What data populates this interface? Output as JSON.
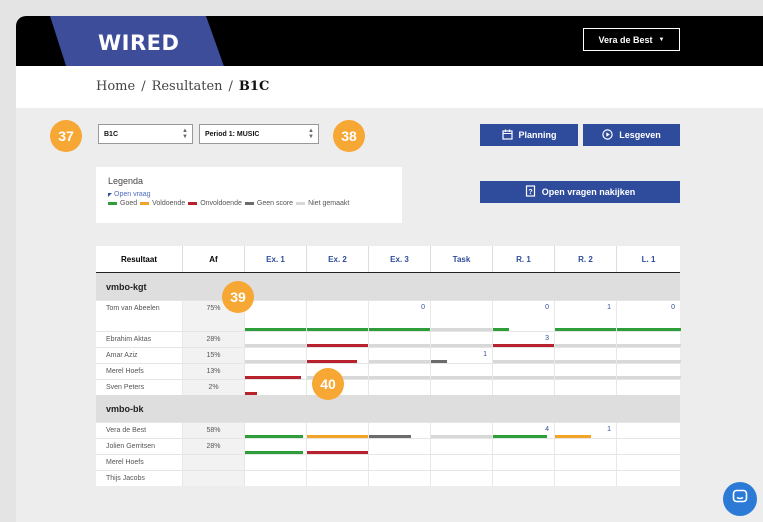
{
  "header": {
    "logo": "WIRED",
    "user_name": "Vera de Best",
    "user_caret": "▼"
  },
  "breadcrumb": {
    "home": "Home",
    "sep1": "/",
    "results": "Resultaten",
    "sep2": "/",
    "current": "B1C"
  },
  "filters": {
    "class_value": "B1C",
    "period_value": "Period 1: MUSIC"
  },
  "buttons": {
    "planning": "Planning",
    "lesgeven": "Lesgeven",
    "open_vragen": "Open vragen nakijken"
  },
  "callouts": {
    "a": "37",
    "b": "38",
    "c": "39",
    "d": "40"
  },
  "legend": {
    "title": "Legenda",
    "open_vraag": "Open vraag",
    "items": [
      {
        "label": "Goed",
        "color": "#2e9e3b"
      },
      {
        "label": "Voldoende",
        "color": "#f2a428"
      },
      {
        "label": "Onvoldoende",
        "color": "#b8222e"
      },
      {
        "label": "Geen score",
        "color": "#6b6b6b"
      },
      {
        "label": "Niet gemaakt",
        "color": "#d8d8d8"
      }
    ]
  },
  "table": {
    "headers": [
      "Resultaat",
      "Af",
      "Ex. 1",
      "Ex. 2",
      "Ex. 3",
      "Task",
      "R. 1",
      "R. 2",
      "L. 1"
    ],
    "groups": [
      {
        "name": "vmbo-kgt",
        "rows": [
          {
            "name": "Tom van Abeelen",
            "af": "75%"
          },
          {
            "name": "Ebrahim Aktas",
            "af": "28%"
          },
          {
            "name": "Amar Aziz",
            "af": "15%"
          },
          {
            "name": "Merel Hoefs",
            "af": "13%"
          },
          {
            "name": "Sven Peters",
            "af": "2%"
          }
        ]
      },
      {
        "name": "vmbo-bk",
        "rows": [
          {
            "name": "Vera de Best",
            "af": "58%"
          },
          {
            "name": "Jolien Gerritsen",
            "af": "28%"
          },
          {
            "name": "Merel Hoefs",
            "af": ""
          },
          {
            "name": "Thijs Jacobs",
            "af": ""
          }
        ]
      }
    ],
    "cell_numbers": {
      "g0r0_ex3": "0",
      "g0r0_r1": "0",
      "g0r0_r2": "1",
      "g0r0_l1": "0",
      "g0r1_r1": "3",
      "g0r2_task": "1",
      "g1r0_r1": "4",
      "g1r0_r2": "1"
    }
  }
}
